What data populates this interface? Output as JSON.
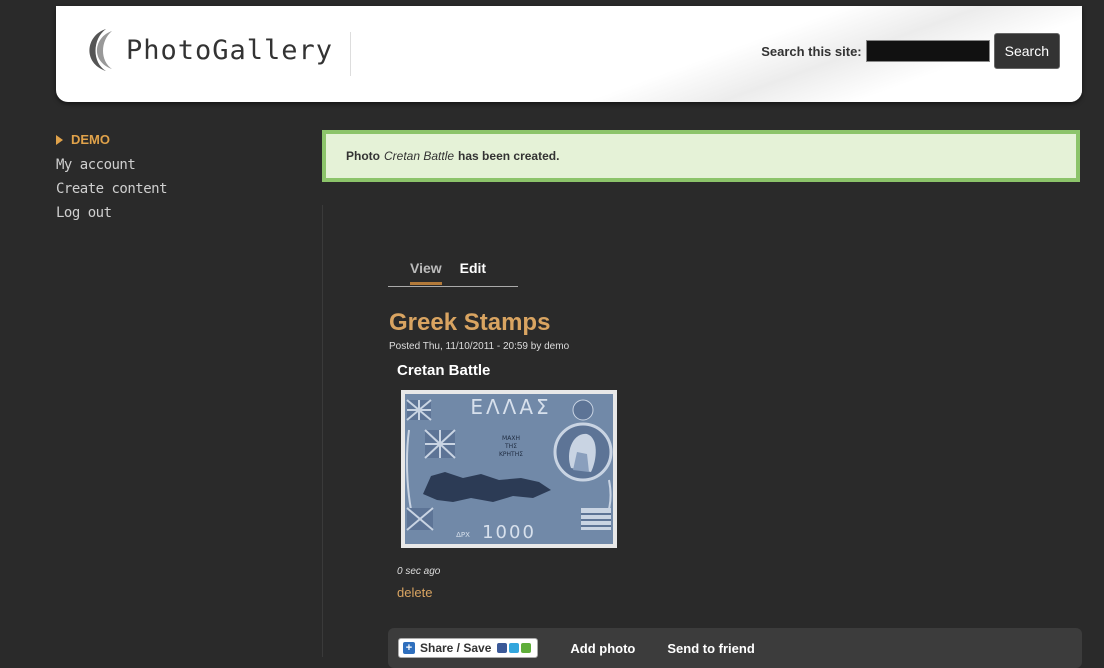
{
  "header": {
    "logo_text": "PhotoGallery",
    "search_label": "Search this site:",
    "search_value": "",
    "search_button": "Search"
  },
  "sidebar": {
    "user": "DEMO",
    "items": [
      {
        "label": "My account"
      },
      {
        "label": "Create content"
      },
      {
        "label": "Log out"
      }
    ]
  },
  "message": {
    "prefix": "Photo",
    "name": "Cretan Battle",
    "suffix": "has been created."
  },
  "tabs": [
    {
      "label": "View"
    },
    {
      "label": "Edit"
    }
  ],
  "node": {
    "title": "Greek Stamps",
    "posted": "Posted Thu, 11/10/2011 - 20:59 by demo",
    "photo_title": "Cretan Battle",
    "stamp": {
      "country": "ΕΛΛΑΣ",
      "line1": "ΜΑΧΗ",
      "line2": "ΤΗΣ",
      "line3": "ΚΡΗΤΗΣ",
      "value": "1000",
      "unit": "ΔΡΧ"
    },
    "age": "0 sec ago",
    "delete": "delete"
  },
  "links": {
    "share": "Share / Save",
    "add_photo": "Add photo",
    "send": "Send to friend"
  },
  "colors": {
    "accent": "#d9a461",
    "message_bg": "#e5f2d7",
    "message_border": "#8cc46a",
    "background": "#2a2a2a"
  }
}
